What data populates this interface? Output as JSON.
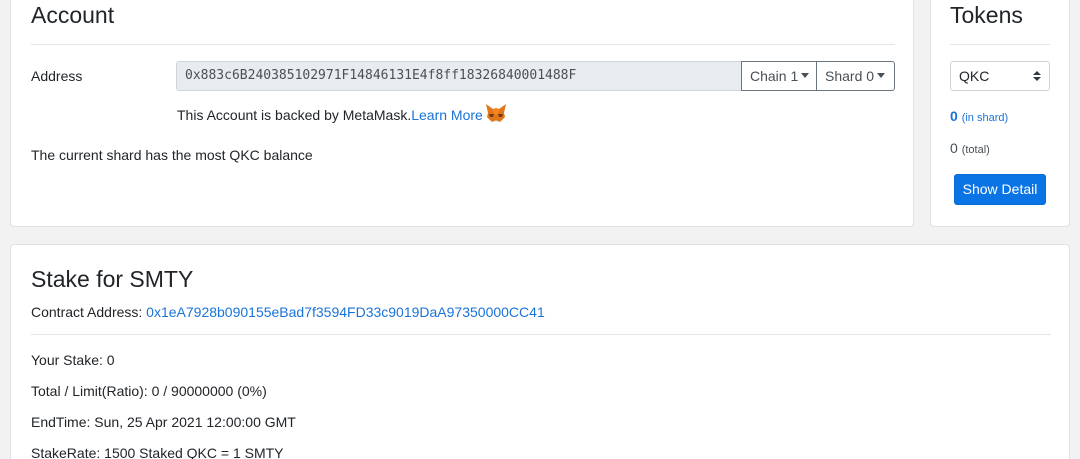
{
  "account": {
    "title": "Account",
    "address_label": "Address",
    "address_value": "0x883c6B240385102971F14846131E4f8ff18326840001488F",
    "chain_label": "Chain 1",
    "shard_label": "Shard 0",
    "metamask_text": "This Account is backed by MetaMask.",
    "learn_more": "Learn More",
    "shard_note": "The current shard has the most QKC balance"
  },
  "tokens": {
    "title": "Tokens",
    "selected_token": "QKC",
    "in_shard_value": "0",
    "in_shard_label": "(in shard)",
    "total_value": "0",
    "total_label": "(total)",
    "show_detail": "Show Detail"
  },
  "stake": {
    "title": "Stake for SMTY",
    "contract_label": "Contract Address:",
    "contract_address": "0x1eA7928b090155eBad7f3594FD33c9019DaA97350000CC41",
    "your_stake": "Your Stake: 0",
    "total_limit": "Total / Limit(Ratio): 0 / 90000000 (0%)",
    "end_time": "EndTime: Sun, 25 Apr 2021 12:00:00 GMT",
    "stake_rate": "StakeRate: 1500 Staked QKC = 1 SMTY"
  },
  "colors": {
    "link": "#1a73d9",
    "primary_button": "#0b74e5",
    "page_background": "#f2f2f2"
  },
  "icons": [
    "metamask-fox-icon",
    "caret-down-icon",
    "select-arrows-icon"
  ]
}
